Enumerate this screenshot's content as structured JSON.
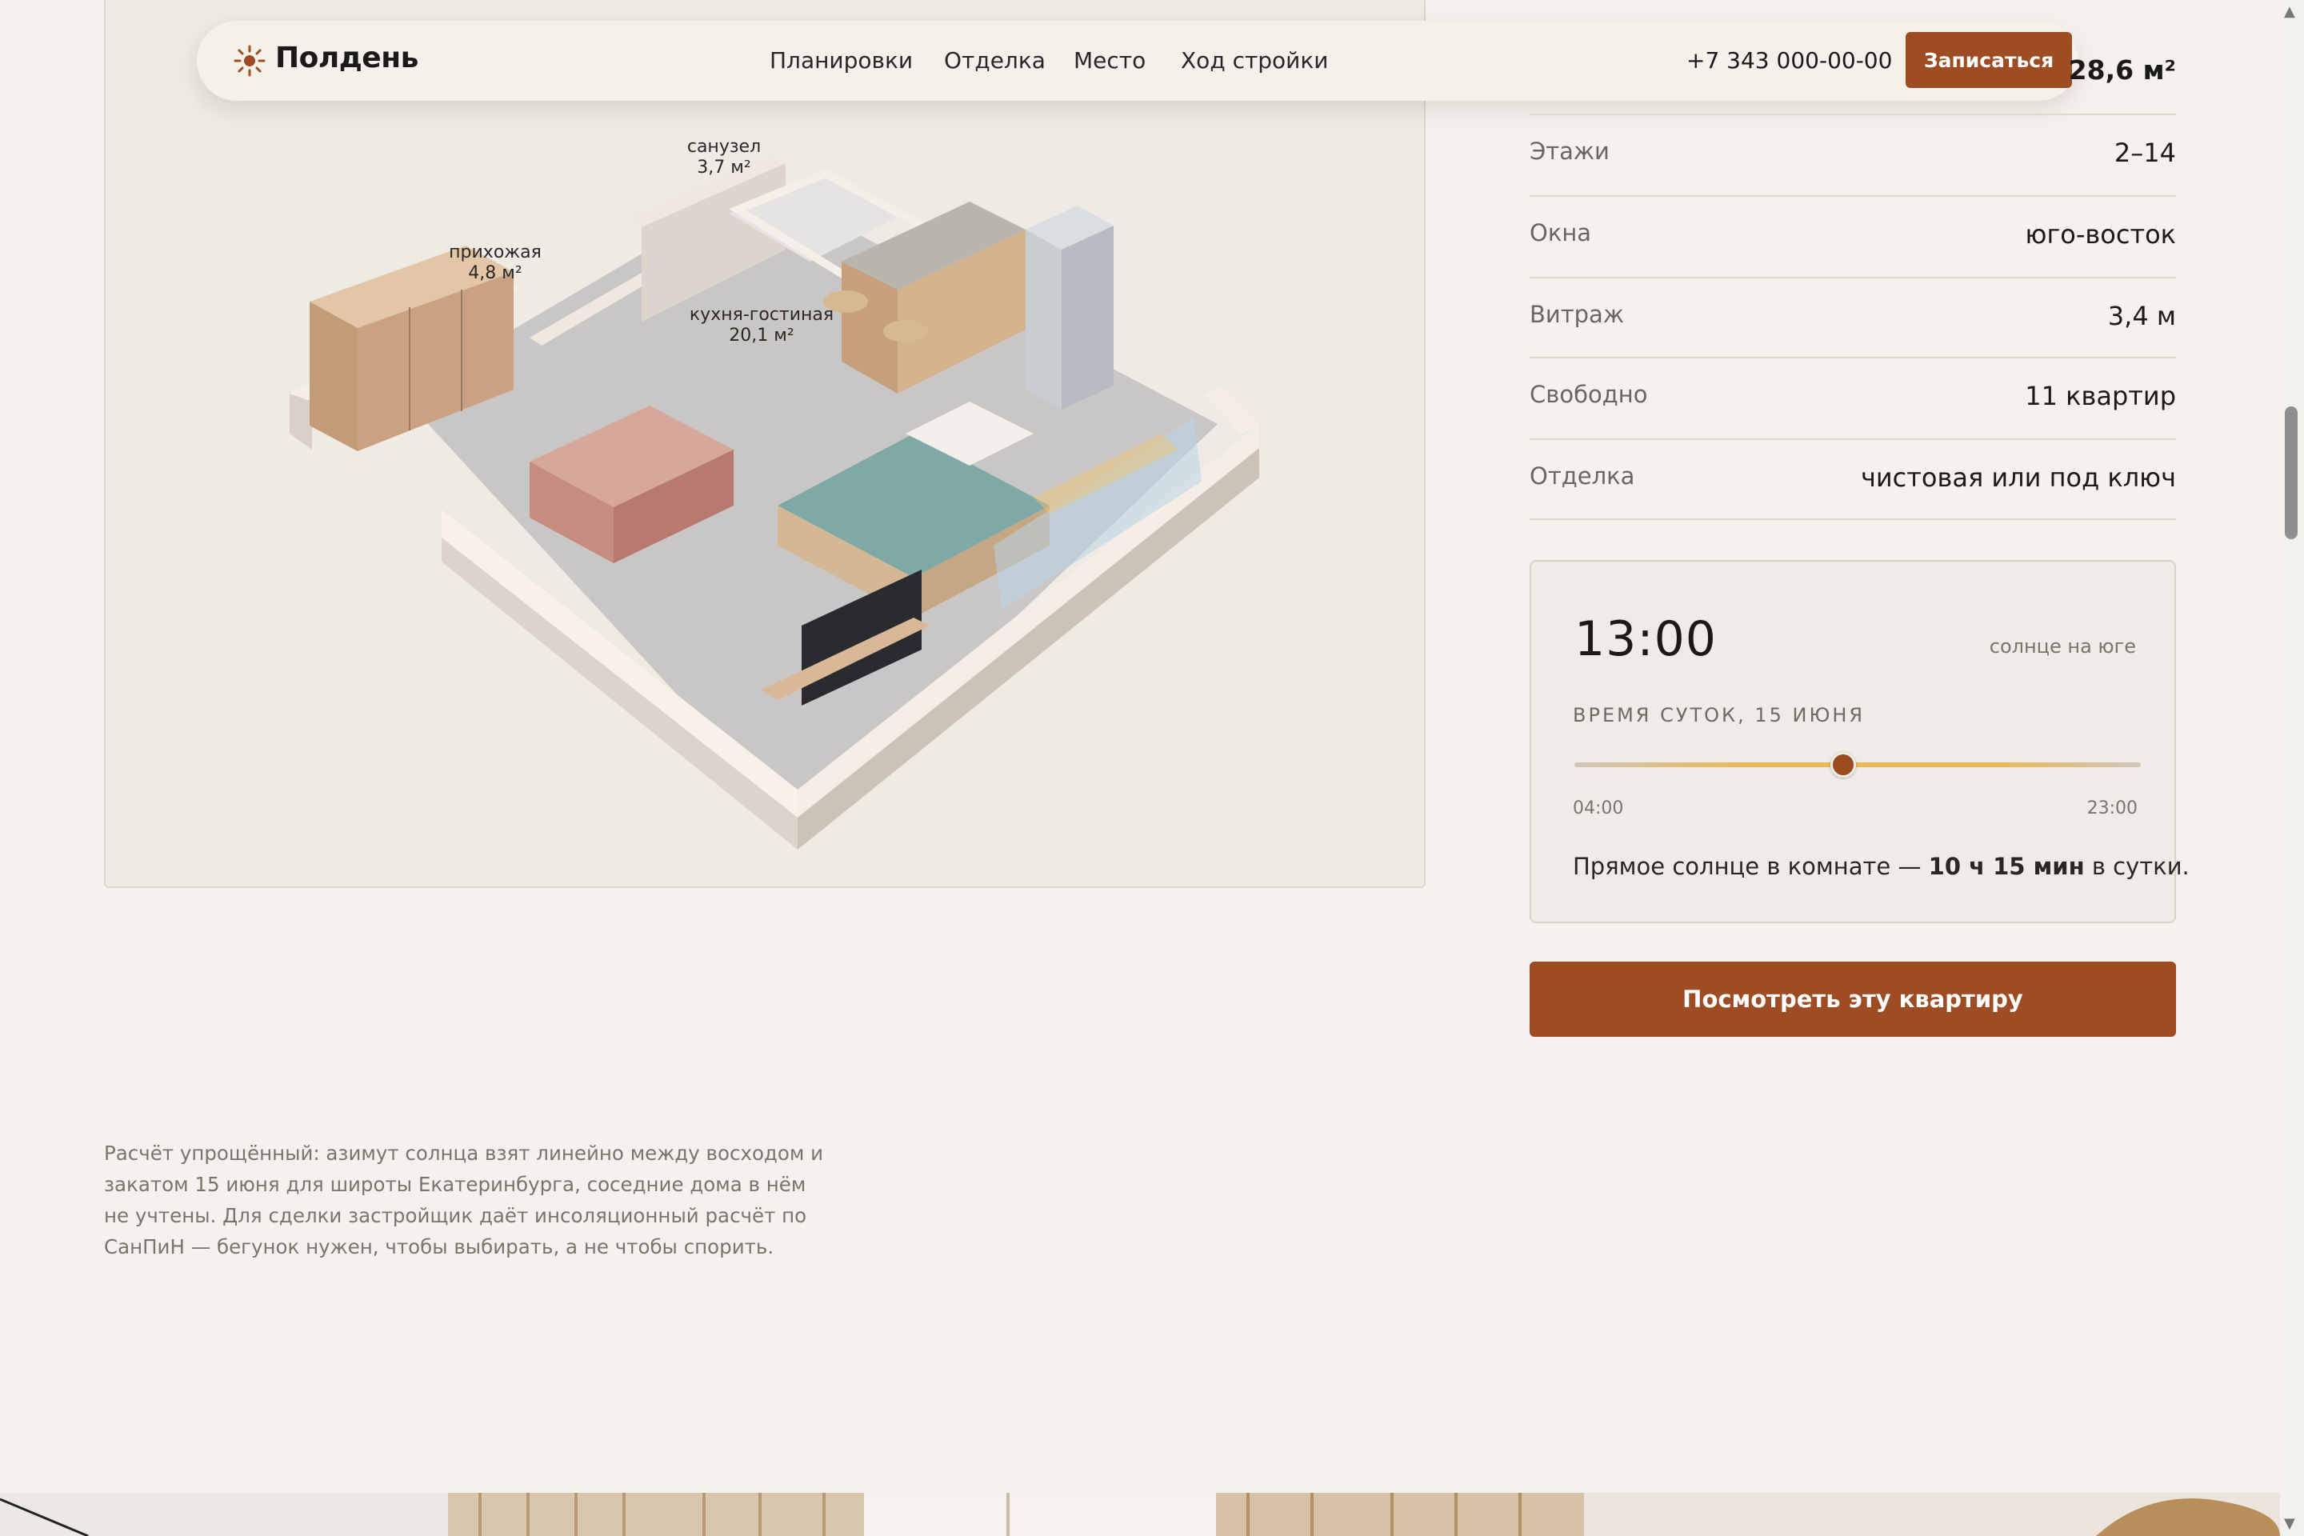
{
  "navbar": {
    "logo_icon": "sun-icon",
    "brand": "Полдень",
    "links": [
      "Планировки",
      "Отделка",
      "Место",
      "Ход стройки"
    ],
    "phone": "+7 343 000-00-00",
    "signup_label": "Записаться"
  },
  "plan": {
    "rooms": [
      {
        "name": "санузел",
        "area": "3,7 м²"
      },
      {
        "name": "прихожая",
        "area": "4,8 м²"
      },
      {
        "name": "кухня-гостиная",
        "area": "20,1 м²"
      }
    ]
  },
  "specs": {
    "area": "28,6 м²",
    "rows": [
      {
        "label": "Этажи",
        "value": "2–14"
      },
      {
        "label": "Окна",
        "value": "юго-восток"
      },
      {
        "label": "Витраж",
        "value": "3,4 м"
      },
      {
        "label": "Свободно",
        "value": "11 квартир"
      },
      {
        "label": "Отделка",
        "value": "чистовая или под ключ"
      }
    ]
  },
  "sun_widget": {
    "time": "13:00",
    "note": "солнце на юге",
    "label": "ВРЕМЯ СУТОК, 15 ИЮНЯ",
    "slider_min": "04:00",
    "slider_max": "23:00",
    "slider_fraction": 0.474,
    "summary_before": "Прямое солнце в комнате — ",
    "summary_bold": "10 ч 15 мин",
    "summary_after": " в сутки."
  },
  "cta_label": "Посмотреть эту квартиру",
  "disclaimer": "Расчёт упрощённый: азимут солнца взят линейно между восходом и закатом 15 июня для широты Екатеринбурга, соседние дома в нём не учтены. Для сделки застройщик даёт инсоляционный расчёт по СанПиН — бегунок нужен, чтобы выбирать, а не чтобы спорить.",
  "colors": {
    "accent": "#9e4c24",
    "background": "#f5f2ed",
    "slider_sun": "#e9b85a"
  }
}
